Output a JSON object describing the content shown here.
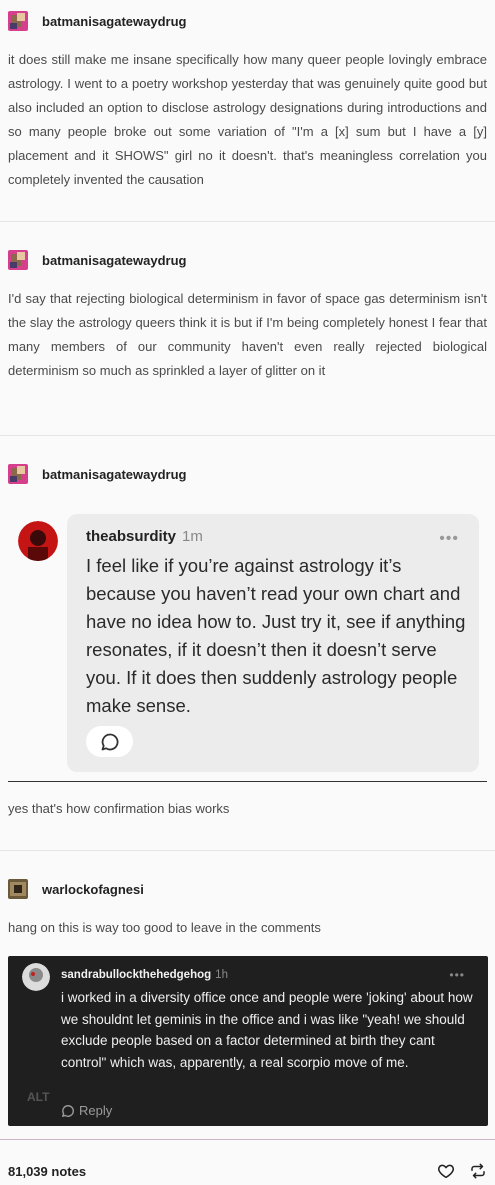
{
  "posts": [
    {
      "username": "batmanisagatewaydrug",
      "text": "it does still make me insane specifically how many queer people lovingly embrace astrology. I went to a poetry workshop yesterday that was genuinely quite good but also included an option to disclose astrology designations during introductions and so many people broke out some variation of \"I'm a [x] sum but I have a [y] placement and it SHOWS\" girl no it doesn't. that's meaningless correlation you completely invented the causation"
    },
    {
      "username": "batmanisagatewaydrug",
      "text": "I'd say that rejecting biological determinism in favor of space gas determinism isn't the slay the astrology queers think it is but if I'm being completely honest I fear that many members of our community haven't even really rejected biological determinism so much as sprinkled a layer of glitter on it"
    },
    {
      "username": "batmanisagatewaydrug",
      "embedded": {
        "username": "theabsurdity",
        "time": "1m",
        "text": "I feel like if you’re against astrology it’s because you haven’t read your own chart and have no idea how to. Just try it, see if anything resonates, if it doesn’t then it doesn’t serve you. If it does then suddenly astrology people make sense."
      },
      "text": "yes that's how confirmation bias works"
    },
    {
      "username": "warlockofagnesi",
      "text": "hang on this is way too good to leave in the comments",
      "embedded": {
        "username": "sandrabullockthehedgehog",
        "time": "1h",
        "text": "i worked in a diversity office once and people were 'joking' about how we shouldnt let geminis in the office and i was like \"yeah! we should exclude people based on a factor determined at birth they cant control\" which was, apparently, a real scorpio move of me.",
        "alt": "ALT",
        "reply_label": "Reply"
      }
    }
  ],
  "footer": {
    "notes": "81,039 notes",
    "like_icon": "heart-icon",
    "reblog_icon": "reblog-icon"
  },
  "colors": {
    "dark_card": "#1f1f1f",
    "light_card": "#ececec"
  }
}
